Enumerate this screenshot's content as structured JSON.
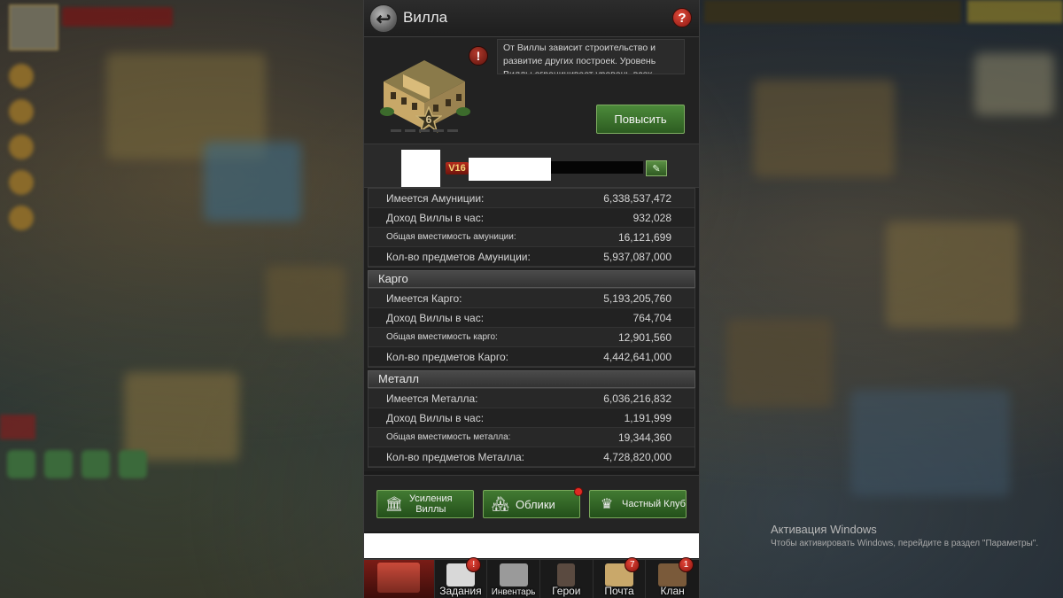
{
  "window": {
    "title": "Вилла",
    "help_glyph": "?",
    "back_glyph": "↩"
  },
  "villa": {
    "level": "6",
    "description": "От Виллы зависит строительство и развитие других построек. Уровень Виллы ограничивает уровень всех",
    "upgrade_label": "Повысить",
    "warn_glyph": "!"
  },
  "player": {
    "vip": "V16",
    "edit_glyph": "✎"
  },
  "sections": [
    {
      "header": "",
      "rows": [
        {
          "label": "Имеется Амуниции:",
          "value": "6,338,537,472",
          "small": false
        },
        {
          "label": "Доход Виллы в час:",
          "value": "932,028",
          "small": false
        },
        {
          "label": "Общая вместимость амуниции:",
          "value": "16,121,699",
          "small": true
        },
        {
          "label": "Кол-во предметов Амуниции:",
          "value": "5,937,087,000",
          "small": false
        }
      ]
    },
    {
      "header": "Карго",
      "rows": [
        {
          "label": "Имеется Карго:",
          "value": "5,193,205,760",
          "small": false
        },
        {
          "label": "Доход Виллы в час:",
          "value": "764,704",
          "small": false
        },
        {
          "label": "Общая вместимость карго:",
          "value": "12,901,560",
          "small": true
        },
        {
          "label": "Кол-во предметов Карго:",
          "value": "4,442,641,000",
          "small": false
        }
      ]
    },
    {
      "header": "Металл",
      "rows": [
        {
          "label": "Имеется Металла:",
          "value": "6,036,216,832",
          "small": false
        },
        {
          "label": "Доход Виллы в час:",
          "value": "1,191,999",
          "small": false
        },
        {
          "label": "Общая вместимость металла:",
          "value": "19,344,360",
          "small": true
        },
        {
          "label": "Кол-во предметов Металла:",
          "value": "4,728,820,000",
          "small": false
        }
      ]
    }
  ],
  "actions": {
    "boosts_line1": "Усиления",
    "boosts_line2": "Виллы",
    "skins": "Облики",
    "club": "Частный Клуб"
  },
  "nav": {
    "tasks": "Задания",
    "inventory": "Инвентарь",
    "heroes": "Герои",
    "mail": "Почта",
    "clan": "Клан",
    "tasks_badge": "!",
    "mail_badge": "7",
    "clan_badge": "1"
  },
  "watermark": {
    "title": "Активация Windows",
    "subtitle": "Чтобы активировать Windows, перейдите в раздел \"Параметры\"."
  },
  "colors": {
    "accent_green": "#427a32",
    "alert_red": "#e02a22",
    "panel_bg": "#1b1b1b"
  }
}
